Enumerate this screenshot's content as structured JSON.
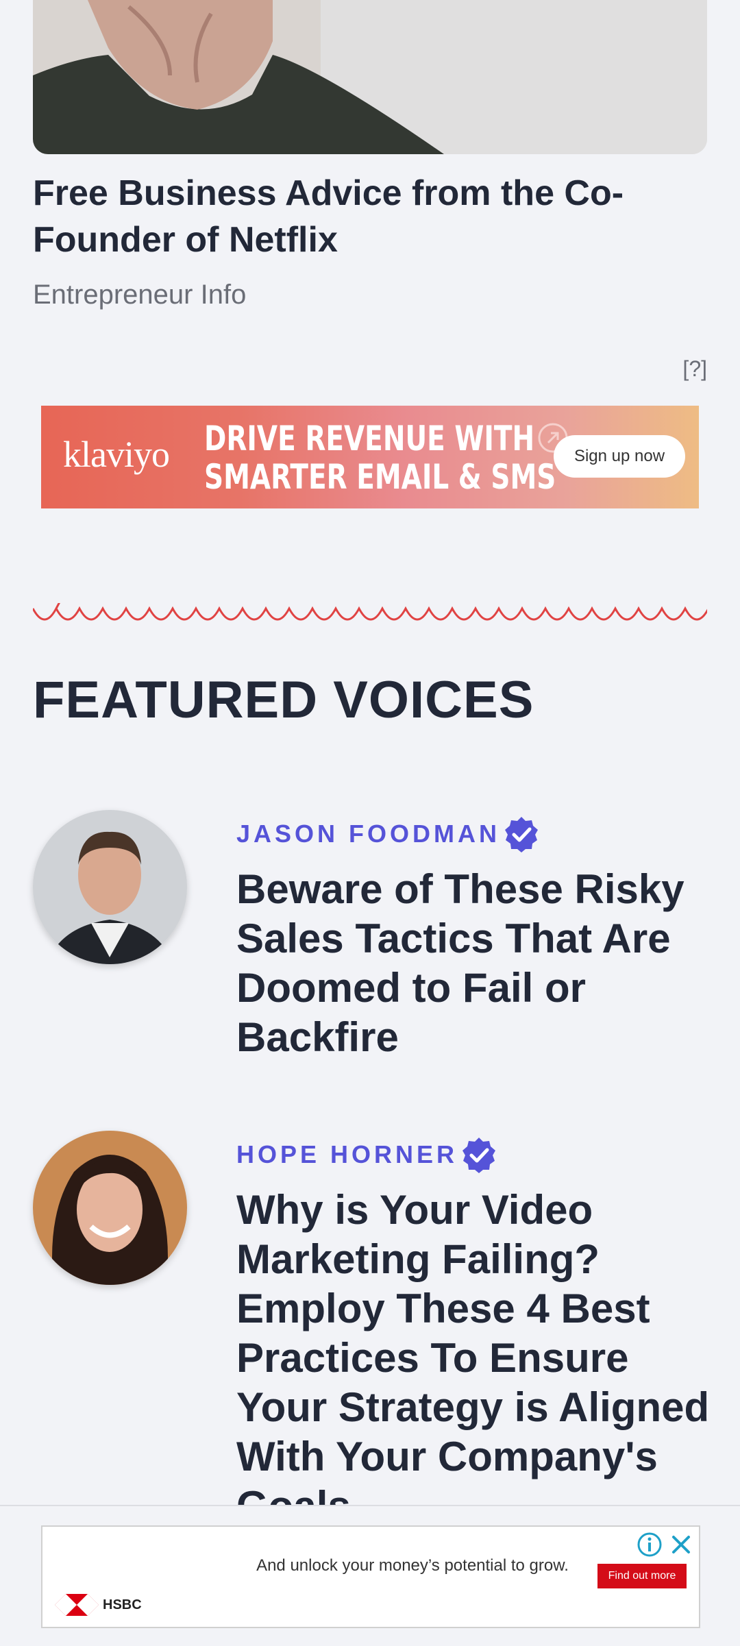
{
  "hero": {
    "title": "Free Business Advice from the Co-Founder of Netflix",
    "source": "Entrepreneur Info"
  },
  "ad_top": {
    "help": "[?]",
    "brand": "klaviyo",
    "headline_line1": "DRIVE REVENUE WITH",
    "headline_line2": "SMARTER EMAIL & SMS",
    "cta": "Sign up now"
  },
  "featured": {
    "heading": "FEATURED VOICES",
    "voices": [
      {
        "author": "JASON FOODMAN",
        "title": "Beware of These Risky Sales Tactics That Are Doomed to Fail or Backfire"
      },
      {
        "author": "HOPE HORNER",
        "title": "Why is Your Video Marketing Failing? Employ These 4 Best Practices To Ensure Your Strategy is Aligned With Your Company's Goals."
      }
    ]
  },
  "ad_bottom": {
    "text": "And unlock your money’s potential to grow.",
    "cta": "Find out more",
    "brand": "HSBC"
  },
  "colors": {
    "accent_author": "#5553d8",
    "wave": "#e04343",
    "hsbc_red": "#d40c18"
  },
  "icons": [
    "verified-badge-icon",
    "adchoices-icon",
    "close-icon",
    "external-arrow-icon",
    "hsbc-hexagon-icon"
  ]
}
